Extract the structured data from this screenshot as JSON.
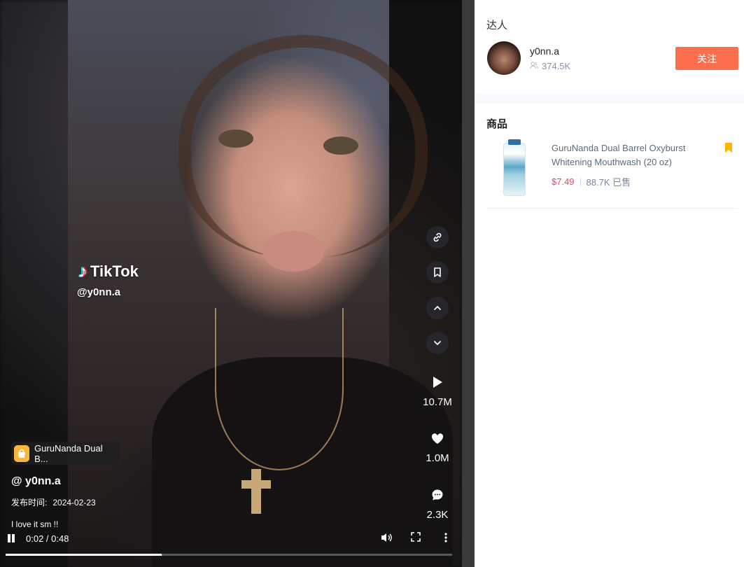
{
  "video": {
    "watermark_brand": "TikTok",
    "watermark_handle": "@y0nn.a",
    "product_pill": "GuruNanda Dual B...",
    "author": "@ y0nn.a",
    "publish_label": "发布时间:",
    "publish_date": "2024-02-23",
    "caption": "I love it sm !!",
    "stats": {
      "plays": "10.7M",
      "likes": "1.0M",
      "comments": "2.3K"
    },
    "time": "0:02 / 0:48",
    "progress_fraction": 0.35
  },
  "panel": {
    "creator_section_title": "达人",
    "creator_name": "y0nn.a",
    "creator_followers": "374.5K",
    "follow_label": "关注",
    "products_section_title": "商品",
    "product": {
      "name": "GuruNanda Dual Barrel Oxyburst Whitening Mouthwash (20 oz)",
      "price": "$7.49",
      "sold": "88.7K 已售"
    }
  },
  "colors": {
    "follow_button": "#fb6f4e",
    "price": "#f0466c",
    "bookmark": "#ffb400",
    "bag_icon": "#f6b73c"
  }
}
